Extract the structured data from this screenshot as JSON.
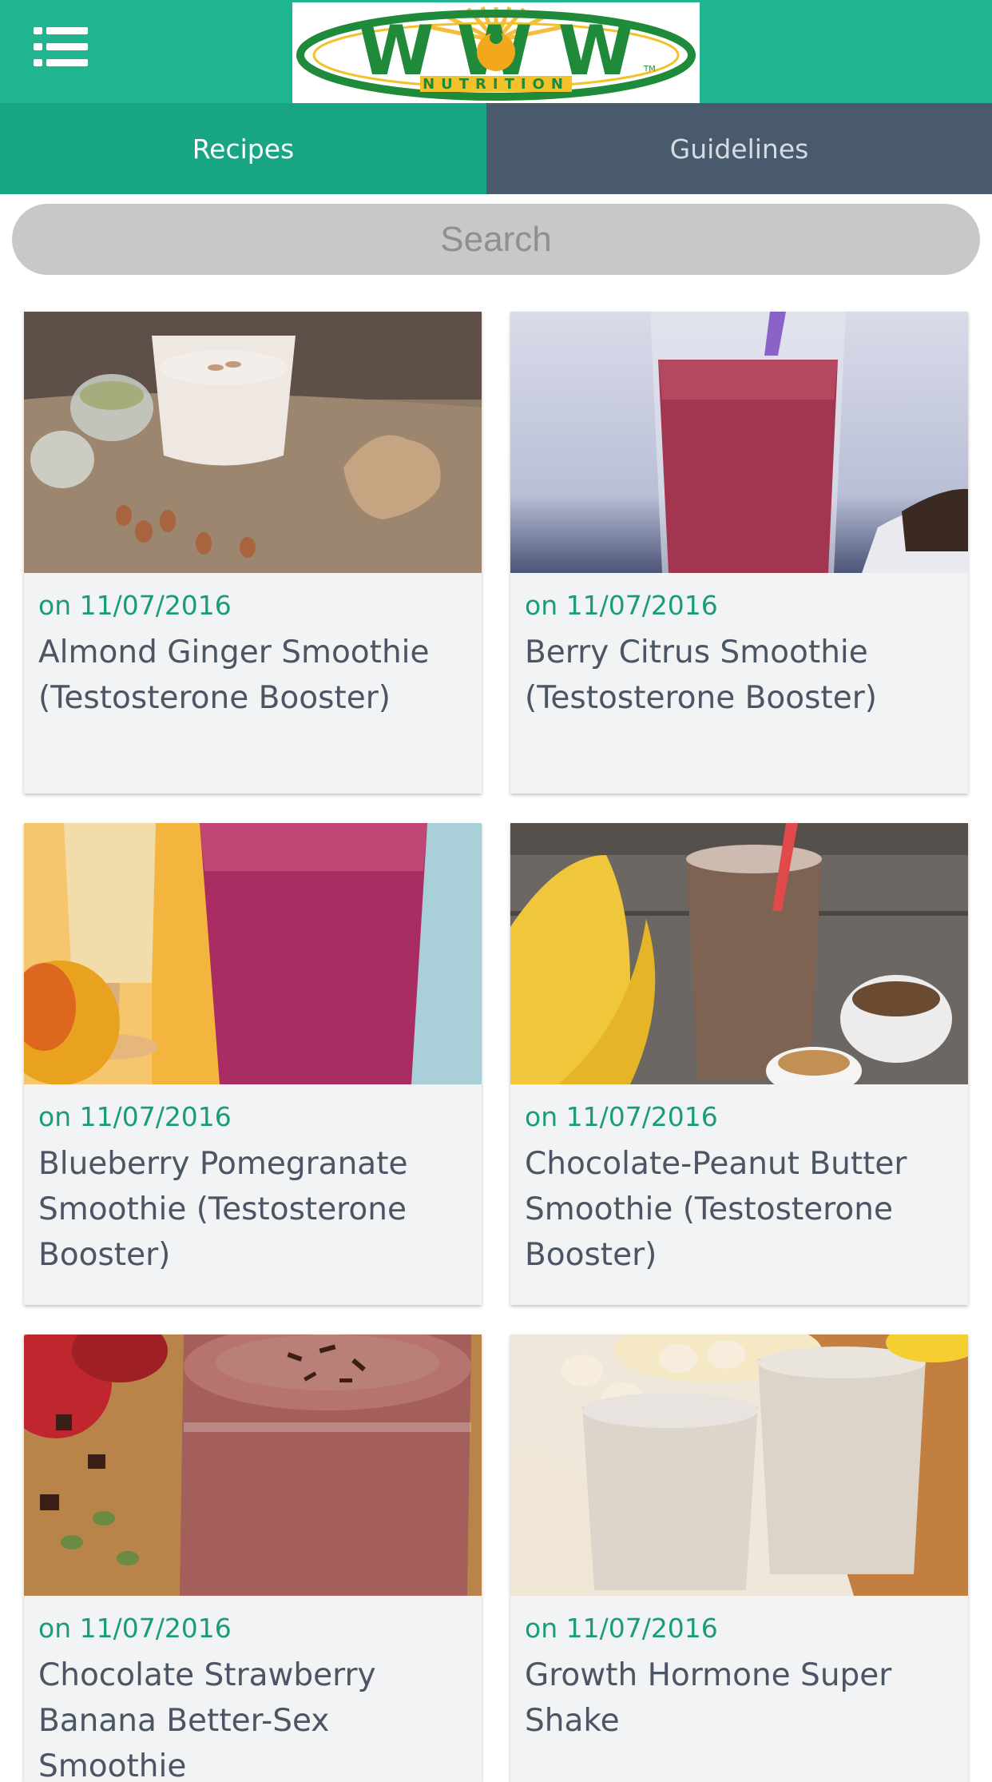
{
  "header": {
    "menu_icon": "hamburger-menu-icon",
    "logo_text": "WOW",
    "logo_subtext": "NUTRITION",
    "logo_tm": "TM",
    "brand_color": "#20b591"
  },
  "tabs": [
    {
      "label": "Recipes",
      "active": true
    },
    {
      "label": "Guidelines",
      "active": false
    }
  ],
  "search": {
    "placeholder": "Search"
  },
  "recipes": [
    {
      "date": "on 11/07/2016",
      "title": "Almond Ginger Smoothie (Testosterone Booster)"
    },
    {
      "date": "on 11/07/2016",
      "title": "Berry Citrus Smoothie (Testosterone Booster)"
    },
    {
      "date": "on 11/07/2016",
      "title": "Blueberry Pomegranate Smoothie (Testosterone Booster)"
    },
    {
      "date": "on 11/07/2016",
      "title": "Chocolate-Peanut Butter Smoothie (Testosterone Booster)"
    },
    {
      "date": "on 11/07/2016",
      "title": "Chocolate Strawberry Banana Better-Sex Smoothie"
    },
    {
      "date": "on 11/07/2016",
      "title": "Growth Hormone Super Shake"
    }
  ]
}
